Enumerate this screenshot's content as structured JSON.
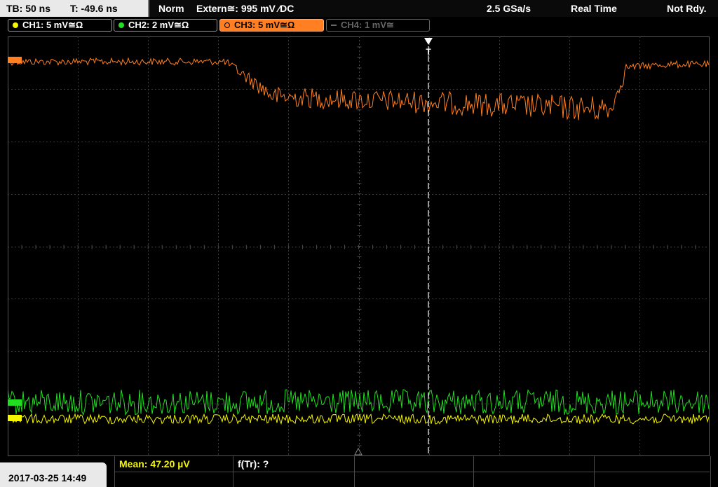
{
  "status_bar": {
    "timebase": "TB: 50 ns",
    "trigger_offset": "T: -49.6 ns",
    "trigger_mode": "Norm",
    "trigger_source": "Extern≅: 995 mV ⁄DC",
    "sample_rate": "2.5 GSa/s",
    "acq_mode": "Real Time",
    "status": "Not Rdy."
  },
  "channels": [
    {
      "label": "CH1: 5 mV≅Ω",
      "color": "#f5f500",
      "active": true
    },
    {
      "label": "CH2: 2 mV≅Ω",
      "color": "#22dd22",
      "active": true
    },
    {
      "label": "CH3: 5 mV≅Ω",
      "color": "#ff7f22",
      "active": true,
      "selected": true
    },
    {
      "label": "CH4: 1 mV≅",
      "color": "#777777",
      "active": false
    }
  ],
  "measurements": {
    "mean": "Mean: 47.20 µV",
    "freq": "f(Tr): ?"
  },
  "datetime": "2017-03-25 14:49",
  "trigger_marker": "T",
  "colors": {
    "ch3": "#ff7f22",
    "ch2": "#22dd22",
    "ch1": "#f5f500",
    "grid": "#3a3a3a"
  }
}
